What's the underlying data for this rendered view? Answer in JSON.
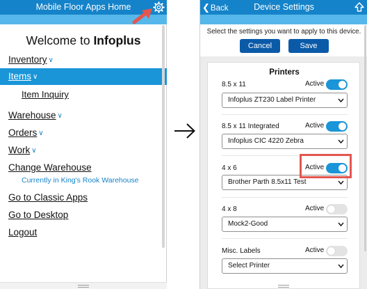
{
  "left_screen": {
    "header_title": "Mobile Floor Apps Home",
    "welcome_prefix": "Welcome to ",
    "welcome_brand": "Infoplus",
    "menu": {
      "inventory": "Inventory",
      "items": "Items",
      "item_inquiry": "Item Inquiry",
      "warehouse": "Warehouse",
      "orders": "Orders",
      "work": "Work",
      "change_warehouse": "Change Warehouse",
      "current_warehouse": "Currently in King's Rook Warehouse",
      "classic_apps": "Go to Classic Apps",
      "desktop": "Go to Desktop",
      "logout": "Logout"
    }
  },
  "right_screen": {
    "back_label": "Back",
    "header_title": "Device Settings",
    "instruction": "Select the settings you want to apply to this device.",
    "cancel_label": "Cancel",
    "save_label": "Save",
    "section_title": "Printers",
    "active_label": "Active",
    "printers": [
      {
        "label": "8.5 x 11",
        "active": true,
        "selected": "Infoplus ZT230 Label Printer"
      },
      {
        "label": "8.5 x 11 Integrated",
        "active": true,
        "selected": "Infoplus CIC 4220 Zebra"
      },
      {
        "label": "4 x 6",
        "active": true,
        "selected": "Brother Parth 8.5x11 Test"
      },
      {
        "label": "4 x 8",
        "active": false,
        "selected": "Mock2-Good"
      },
      {
        "label": "Misc. Labels",
        "active": false,
        "selected": "Select Printer"
      }
    ]
  },
  "colors": {
    "header_blue": "#1583c9",
    "strip_blue": "#56b7ea",
    "button_blue": "#0a5aa8",
    "toggle_on": "#1a95d8",
    "highlight_red": "#e3564f"
  },
  "icons": [
    "gear-icon",
    "pointer-arrow-icon",
    "right-arrow-icon",
    "back-chevron-icon",
    "up-arrow-icon",
    "dropdown-caret-icon"
  ]
}
